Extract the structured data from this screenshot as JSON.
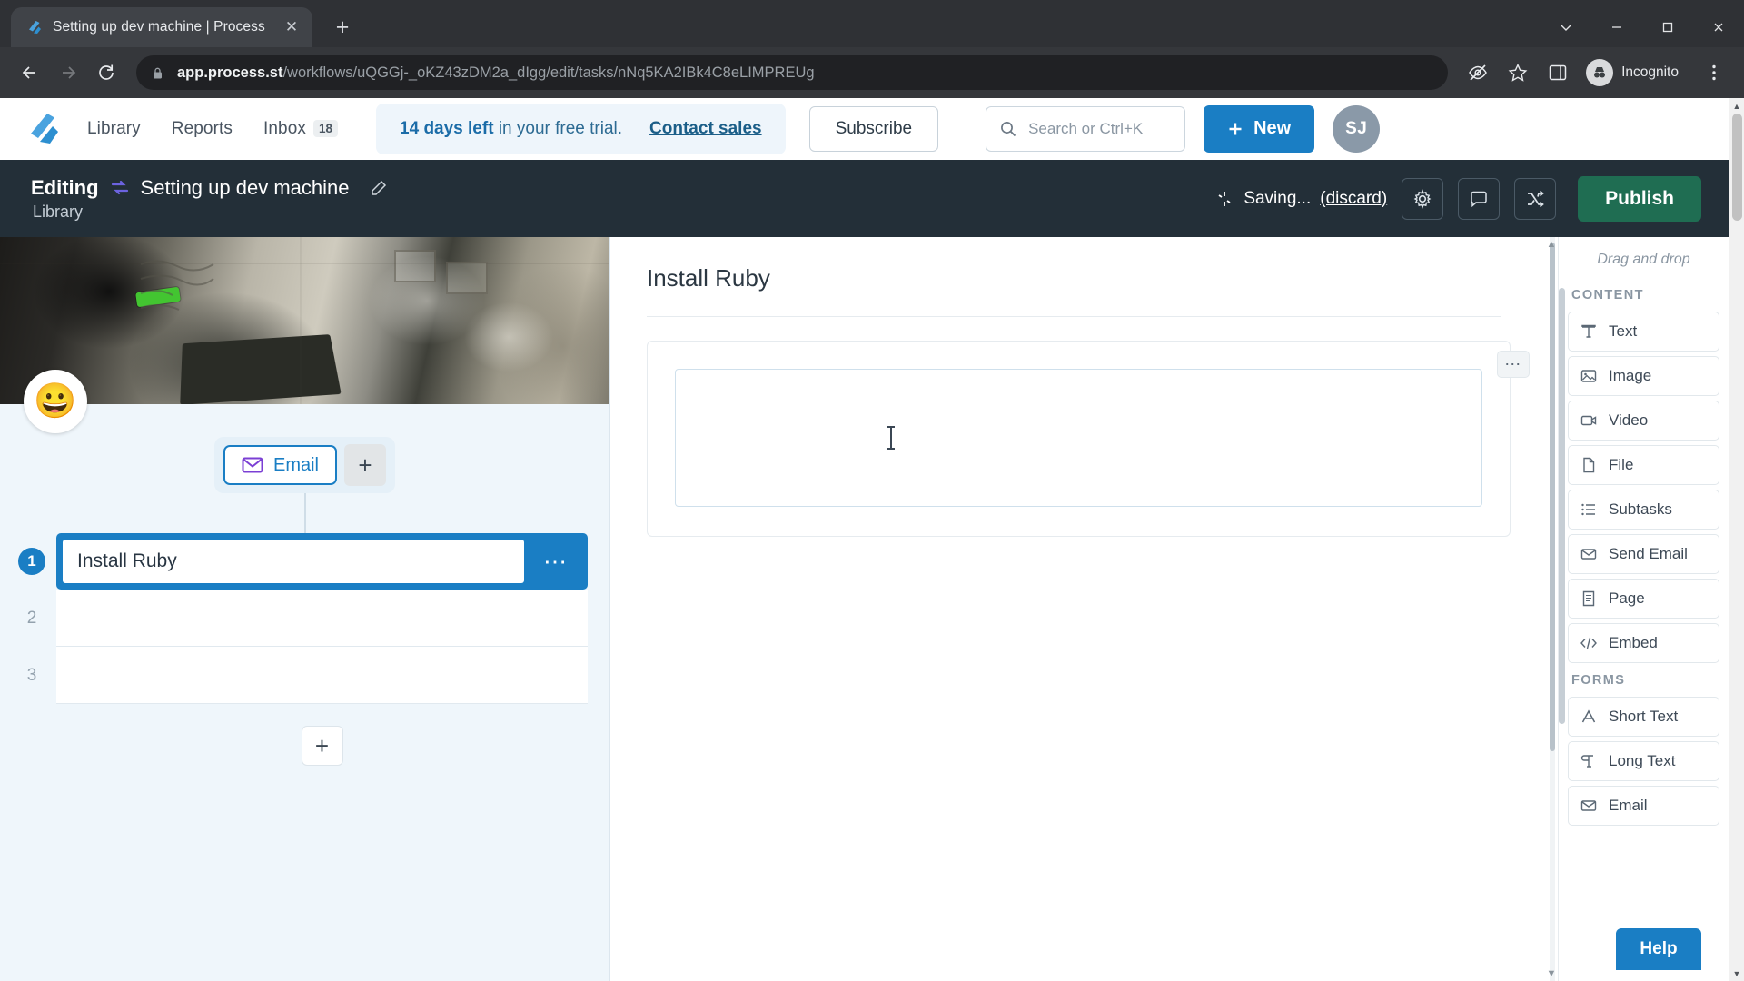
{
  "browser": {
    "tab": {
      "title": "Setting up dev machine | Process",
      "favicon_icon": "process-street-logo-icon",
      "close_icon": "close-icon"
    },
    "new_tab_icon": "plus-icon",
    "window_controls": {
      "chevron_down_icon": "chevron-down-icon",
      "minimize_icon": "minimize-icon",
      "maximize_icon": "maximize-icon",
      "close_icon": "window-close-icon"
    },
    "nav": {
      "back_icon": "arrow-left-icon",
      "forward_icon": "arrow-right-icon",
      "reload_icon": "reload-icon"
    },
    "omnibox": {
      "lock_icon": "lock-icon",
      "url_host": "app.process.st",
      "url_path": "/workflows/uQGGj-_oKZ43zDM2a_dIgg/edit/tasks/nNq5KA2IBk4C8eLIMPREUg"
    },
    "toolbar_icons": {
      "tracking_protection_icon": "eye-slash-icon",
      "bookmark_icon": "star-icon",
      "side_panel_icon": "side-panel-icon"
    },
    "incognito": {
      "label": "Incognito",
      "avatar_icon": "incognito-avatar-icon",
      "menu_icon": "kebab-menu-icon"
    }
  },
  "appnav": {
    "brand_icon": "process-street-brand-icon",
    "links": [
      {
        "label": "Library"
      },
      {
        "label": "Reports"
      }
    ],
    "inbox": {
      "label": "Inbox",
      "badge": "18"
    },
    "trial": {
      "days": "14 days left",
      "rest": "in your free trial.",
      "link": "Contact sales"
    },
    "subscribe_label": "Subscribe",
    "search": {
      "icon": "search-icon",
      "placeholder": "Search or Ctrl+K"
    },
    "new_button": {
      "icon": "plus-icon",
      "label": "New"
    },
    "avatar_initials": "SJ"
  },
  "edit_header": {
    "editing_label": "Editing",
    "workflow_icon": "workflow-swap-icon",
    "workflow_name": "Setting up dev machine",
    "rename_icon": "pencil-edit-icon",
    "subtitle": "Library",
    "saving": {
      "spinner_icon": "saving-spinner-icon",
      "text": "Saving...",
      "discard_label": "(discard)"
    },
    "settings_icon": "gear-icon",
    "comments_icon": "comment-bubble-icon",
    "shuffle_icon": "shuffle-icon",
    "publish_label": "Publish",
    "accent_publish": "#1f6d52"
  },
  "left_panel": {
    "cover_emoji": "😀",
    "chip": {
      "email_icon": "envelope-icon",
      "email_label": "Email",
      "add_icon": "plus-icon"
    },
    "tasks": [
      {
        "num": "1",
        "title": "Install Ruby",
        "active": true,
        "menu_icon": "ellipsis-icon"
      },
      {
        "num": "2",
        "title": "",
        "active": false
      },
      {
        "num": "3",
        "title": "",
        "active": false
      }
    ],
    "add_task_icon": "plus-icon"
  },
  "middle_panel": {
    "title": "Install Ruby",
    "widget_menu_icon": "ellipsis-icon",
    "field_value": "",
    "scroll_up_icon": "caret-up-icon",
    "scroll_down_icon": "caret-down-icon"
  },
  "right_panel": {
    "drag_hint": "Drag and drop",
    "sections": [
      {
        "label": "CONTENT",
        "items": [
          {
            "label": "Text",
            "icon": "text-icon"
          },
          {
            "label": "Image",
            "icon": "image-icon"
          },
          {
            "label": "Video",
            "icon": "video-icon"
          },
          {
            "label": "File",
            "icon": "file-icon"
          },
          {
            "label": "Subtasks",
            "icon": "subtasks-list-icon"
          },
          {
            "label": "Send Email",
            "icon": "envelope-icon"
          },
          {
            "label": "Page",
            "icon": "page-icon"
          },
          {
            "label": "Embed",
            "icon": "code-embed-icon"
          }
        ]
      },
      {
        "label": "FORMS",
        "items": [
          {
            "label": "Short Text",
            "icon": "short-text-icon"
          },
          {
            "label": "Long Text",
            "icon": "long-text-icon"
          },
          {
            "label": "Email",
            "icon": "envelope-icon"
          }
        ]
      }
    ]
  },
  "help": {
    "label": "Help",
    "accent": "#1a7ec4"
  }
}
